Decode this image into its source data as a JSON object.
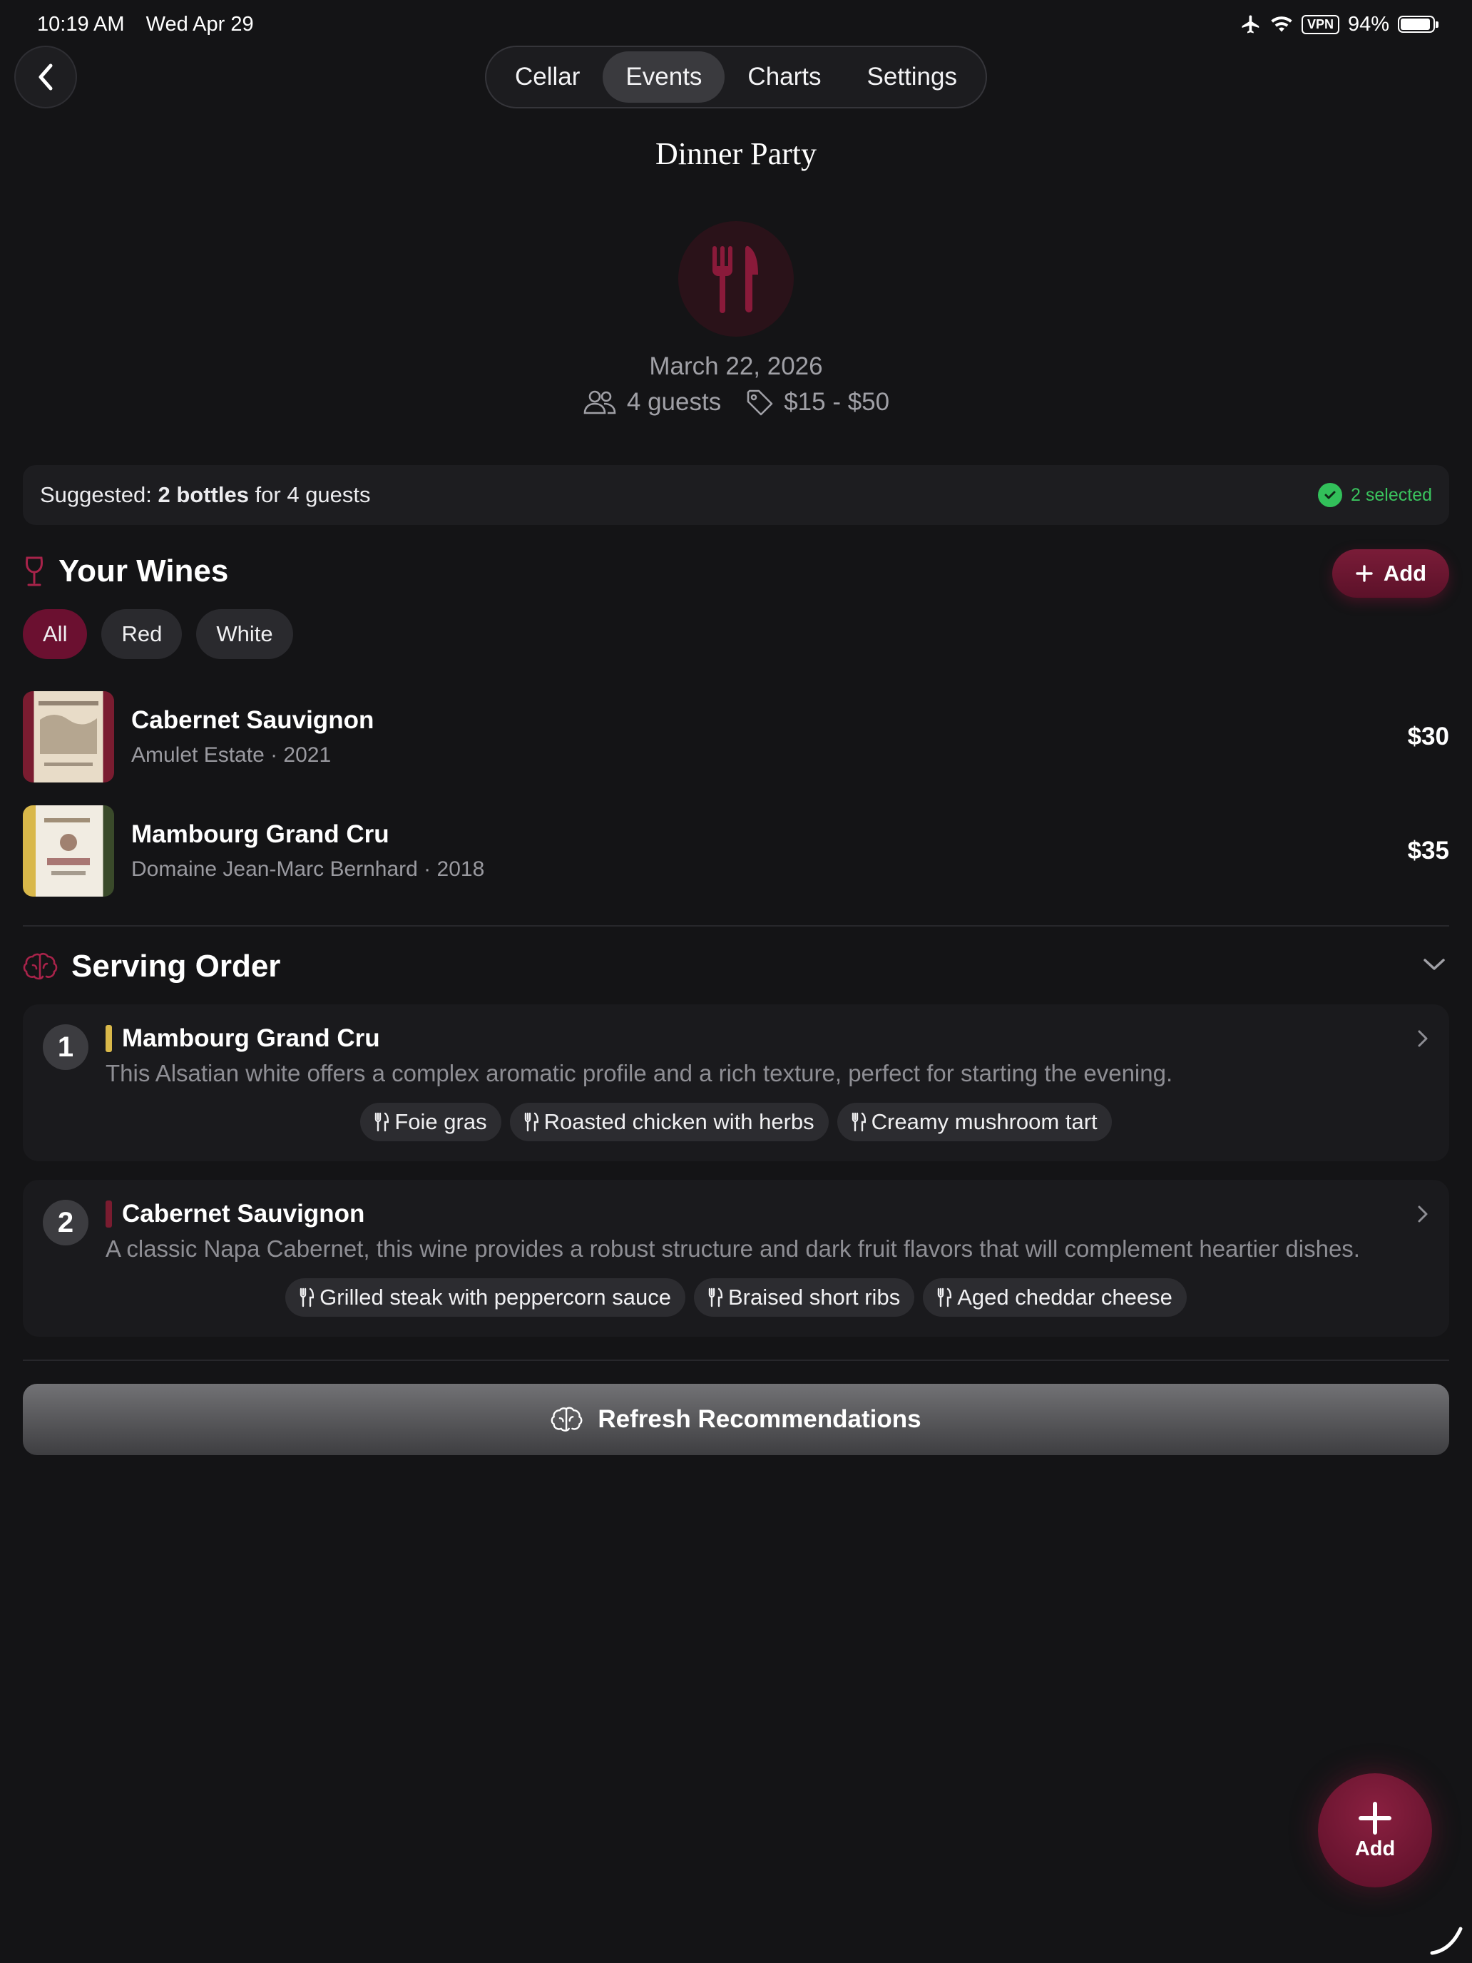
{
  "status_bar": {
    "time": "10:19 AM",
    "date": "Wed Apr 29",
    "vpn": "VPN",
    "battery": "94%",
    "battery_level": 0.94
  },
  "nav": {
    "tabs": [
      {
        "label": "Cellar",
        "active": false
      },
      {
        "label": "Events",
        "active": true
      },
      {
        "label": "Charts",
        "active": false
      },
      {
        "label": "Settings",
        "active": false
      }
    ]
  },
  "event": {
    "title": "Dinner Party",
    "icon": "fork-knife-icon",
    "date": "March 22, 2026",
    "guests": "4 guests",
    "price_range": "$15 - $50"
  },
  "suggestion": {
    "prefix": "Suggested: ",
    "bottles": "2 bottles",
    "suffix": " for 4 guests",
    "selected": "2 selected"
  },
  "your_wines": {
    "title": "Your Wines",
    "add_label": "Add",
    "filters": [
      {
        "label": "All",
        "active": true
      },
      {
        "label": "Red",
        "active": false
      },
      {
        "label": "White",
        "active": false
      }
    ],
    "items": [
      {
        "name": "Cabernet Sauvignon",
        "subtitle": "Amulet Estate · 2021",
        "price": "$30",
        "accent": "#7a1c30"
      },
      {
        "name": "Mambourg Grand Cru",
        "subtitle": "Domaine Jean-Marc Bernhard · 2018",
        "price": "$35",
        "accent": "#d9b84a"
      }
    ]
  },
  "serving_order": {
    "title": "Serving Order",
    "items": [
      {
        "number": "1",
        "name": "Mambourg Grand Cru",
        "color": "#d9b84a",
        "description": "This Alsatian white offers a complex aromatic profile and a rich texture, perfect for starting the evening.",
        "pairings": [
          "Foie gras",
          "Roasted chicken with herbs",
          "Creamy mushroom tart"
        ]
      },
      {
        "number": "2",
        "name": "Cabernet Sauvignon",
        "color": "#7a1c30",
        "description": "A classic Napa Cabernet, this wine provides a robust structure and dark fruit flavors that will complement heartier dishes.",
        "pairings": [
          "Grilled steak with peppercorn sauce",
          "Braised short ribs",
          "Aged cheddar cheese"
        ]
      }
    ]
  },
  "refresh": {
    "label": "Refresh Recommendations"
  },
  "fab": {
    "label": "Add"
  },
  "colors": {
    "accent": "#7a1c38",
    "background": "#141416",
    "success": "#32c05a"
  }
}
